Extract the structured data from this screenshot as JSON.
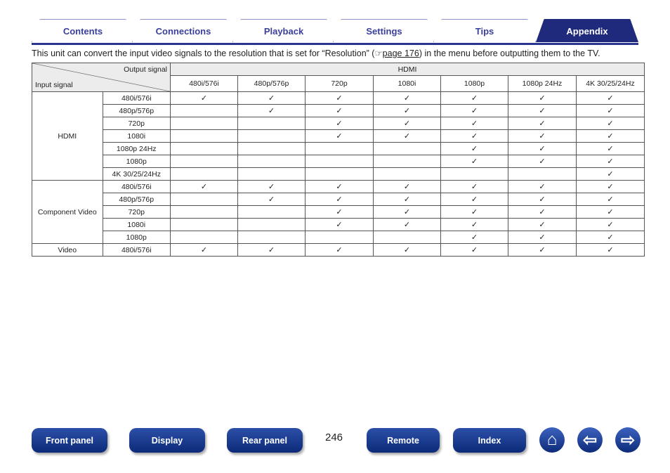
{
  "tabs": [
    {
      "label": "Contents"
    },
    {
      "label": "Connections"
    },
    {
      "label": "Playback"
    },
    {
      "label": "Settings"
    },
    {
      "label": "Tips"
    },
    {
      "label": "Appendix",
      "active": true
    }
  ],
  "intro": {
    "before": "This unit can convert the input video signals to the resolution that is set for “Resolution” (",
    "link": "page 176",
    "after": ") in the menu before outputting them to the TV."
  },
  "table": {
    "output_label": "Output signal",
    "input_label": "Input signal",
    "output_group": "HDMI",
    "columns": [
      "480i/576i",
      "480p/576p",
      "720p",
      "1080i",
      "1080p",
      "1080p 24Hz",
      "4K 30/25/24Hz"
    ],
    "check": "✓",
    "groups": [
      {
        "name": "HDMI",
        "rows": [
          {
            "label": "480i/576i",
            "checks": [
              1,
              1,
              1,
              1,
              1,
              1,
              1
            ]
          },
          {
            "label": "480p/576p",
            "checks": [
              0,
              1,
              1,
              1,
              1,
              1,
              1
            ]
          },
          {
            "label": "720p",
            "checks": [
              0,
              0,
              1,
              1,
              1,
              1,
              1
            ]
          },
          {
            "label": "1080i",
            "checks": [
              0,
              0,
              1,
              1,
              1,
              1,
              1
            ]
          },
          {
            "label": "1080p 24Hz",
            "checks": [
              0,
              0,
              0,
              0,
              1,
              1,
              1
            ]
          },
          {
            "label": "1080p",
            "checks": [
              0,
              0,
              0,
              0,
              1,
              1,
              1
            ]
          },
          {
            "label": "4K 30/25/24Hz",
            "checks": [
              0,
              0,
              0,
              0,
              0,
              0,
              1
            ]
          }
        ]
      },
      {
        "name": "Component Video",
        "rows": [
          {
            "label": "480i/576i",
            "checks": [
              1,
              1,
              1,
              1,
              1,
              1,
              1
            ]
          },
          {
            "label": "480p/576p",
            "checks": [
              0,
              1,
              1,
              1,
              1,
              1,
              1
            ]
          },
          {
            "label": "720p",
            "checks": [
              0,
              0,
              1,
              1,
              1,
              1,
              1
            ]
          },
          {
            "label": "1080i",
            "checks": [
              0,
              0,
              1,
              1,
              1,
              1,
              1
            ]
          },
          {
            "label": "1080p",
            "checks": [
              0,
              0,
              0,
              0,
              1,
              1,
              1
            ]
          }
        ]
      },
      {
        "name": "Video",
        "rows": [
          {
            "label": "480i/576i",
            "checks": [
              1,
              1,
              1,
              1,
              1,
              1,
              1
            ]
          }
        ]
      }
    ]
  },
  "footer": {
    "buttons": [
      "Front panel",
      "Display",
      "Rear panel",
      "Remote",
      "Index"
    ],
    "page": "246",
    "icons": [
      "home-icon",
      "arrow-left-icon",
      "arrow-right-icon"
    ]
  }
}
